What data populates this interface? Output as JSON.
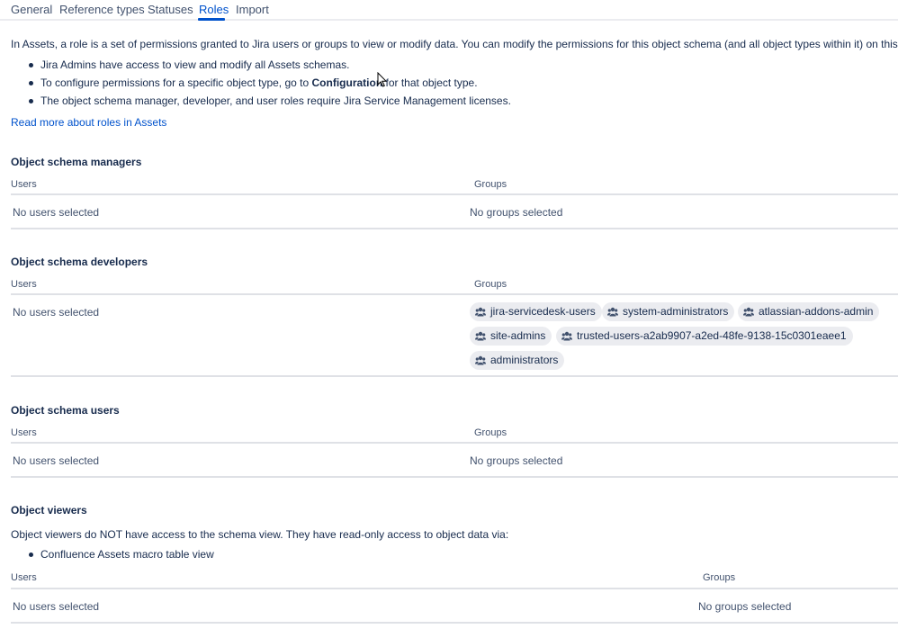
{
  "tabs": [
    {
      "label": "General"
    },
    {
      "label": "Reference types"
    },
    {
      "label": "Statuses"
    },
    {
      "label": "Roles"
    },
    {
      "label": "Import"
    }
  ],
  "intro": {
    "text": "In Assets, a role is a set of permissions granted to Jira users or groups to view or modify data. You can modify the permissions for this object schema (and all object types within it) on this page",
    "bullet1": "Jira Admins have access to view and modify all Assets schemas.",
    "bullet2_before": "To configure permissions for a specific object type, go to",
    "bullet2_bold": "Configuration",
    "bullet2_after": "for that object type.",
    "bullet3": "The object schema manager, developer, and user roles require Jira Service Management licenses.",
    "read_more": "Read more about roles in Assets"
  },
  "managers": {
    "title": "Object schema managers",
    "users_head": "Users",
    "groups_head": "Groups",
    "users_value": "No users selected",
    "groups_value": "No groups selected"
  },
  "developers": {
    "title": "Object schema developers",
    "users_head": "Users",
    "groups_head": "Groups",
    "users_value": "No users selected",
    "groups": [
      "jira-servicedesk-users",
      "system-administrators",
      "atlassian-addons-admin",
      "site-admins",
      "trusted-users-a2ab9907-a2ed-48fe-9138-15c0301eaee1",
      "administrators"
    ]
  },
  "schema_users": {
    "title": "Object schema users",
    "users_head": "Users",
    "groups_head": "Groups",
    "users_value": "No users selected",
    "groups_value": "No groups selected"
  },
  "viewers": {
    "title": "Object viewers",
    "description": "Object viewers do NOT have access to the schema view. They have read-only access to object data via:",
    "bullet1": "Confluence Assets macro table view",
    "users_head": "Users",
    "groups_head": "Groups",
    "users_value": "No users selected",
    "groups_value": "No groups selected"
  },
  "icons": {
    "group": "people-group-icon",
    "cursor": "mouse-pointer-icon"
  },
  "colors": {
    "accent": "#0052cc",
    "text": "#172b4d",
    "subtle": "#42526e",
    "chip_bg": "#ebecf0",
    "divider": "#dfe1e6"
  }
}
